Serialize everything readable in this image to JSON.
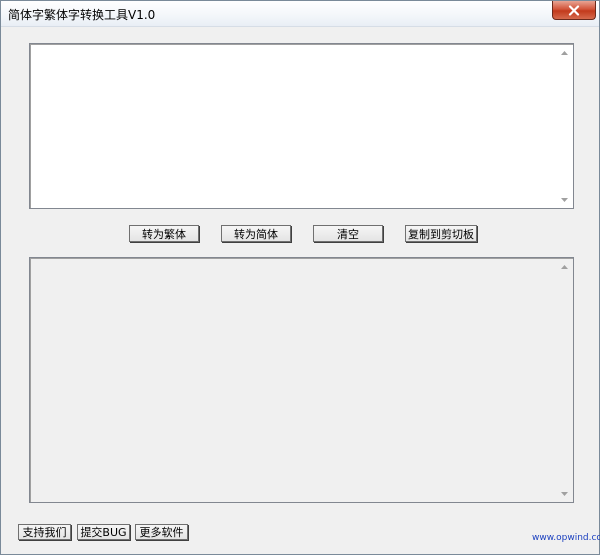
{
  "window": {
    "title": "简体字繁体字转换工具V1.0"
  },
  "buttons": {
    "to_traditional": "转为繁体",
    "to_simplified": "转为简体",
    "clear": "清空",
    "copy_clipboard": "复制到剪切板"
  },
  "footer": {
    "support": "支持我们",
    "submit_bug": "提交BUG",
    "more_software": "更多软件",
    "website": "www.opwind.com"
  },
  "input": {
    "value": ""
  },
  "output": {
    "value": ""
  },
  "icons": {
    "close": "close-icon",
    "scroll_up": "scroll-up-icon",
    "scroll_down": "scroll-down-icon"
  },
  "colors": {
    "close_button": "#c23a1d",
    "link": "#1a3fbf",
    "window_bg": "#f0f0f0"
  }
}
